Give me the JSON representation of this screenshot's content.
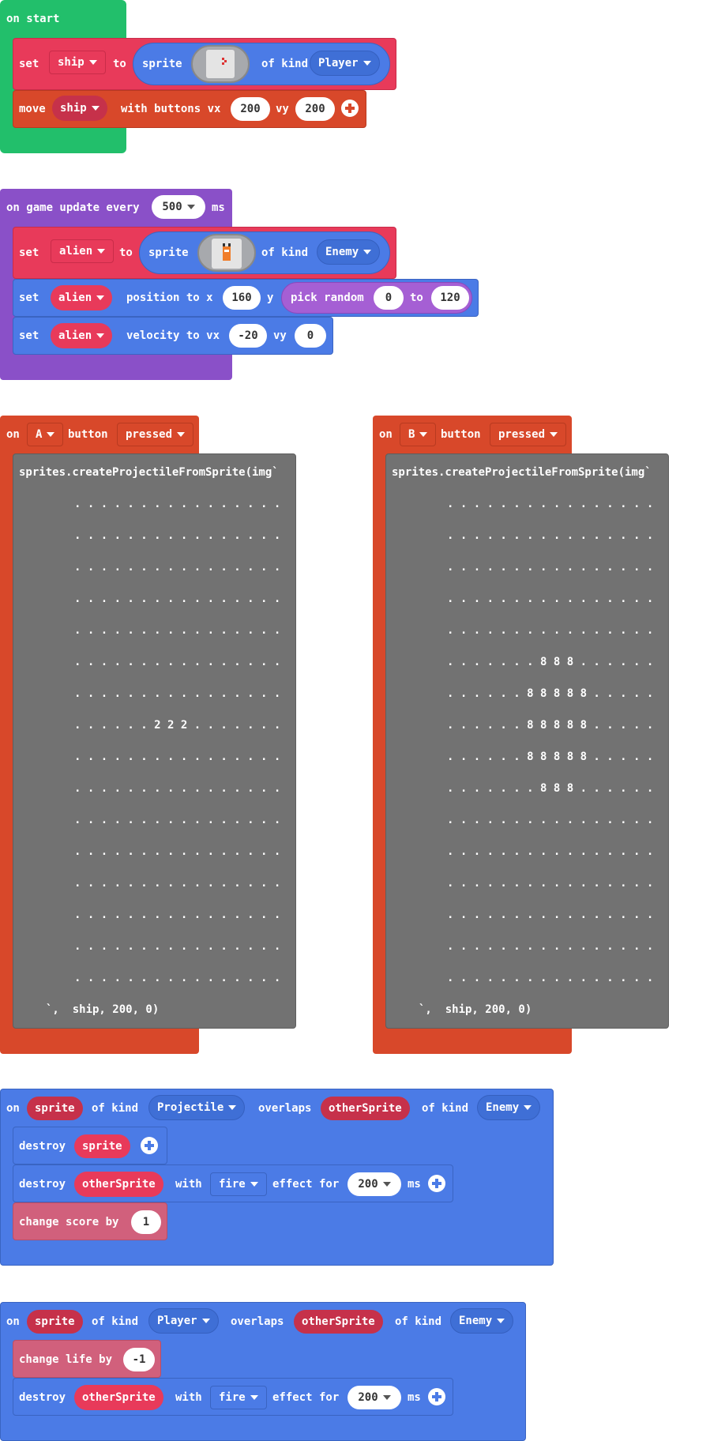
{
  "colors": {
    "event_green": "#22bf6b",
    "sprites_red": "#e83a5a",
    "controller_orange": "#d8482a",
    "game_purple": "#8a50c8",
    "sprite_blue": "#4b7be6",
    "info_pink": "#d1607c",
    "code_gray": "#727272",
    "reporter_blue": "#3f6fd6"
  },
  "on_start": {
    "label": "on start",
    "set_block": {
      "set": "set",
      "var": "ship",
      "to": "to",
      "sprite": "sprite",
      "of_kind": "of kind",
      "kind": "Player"
    },
    "move_block": {
      "move": "move",
      "var": "ship",
      "with_buttons": "with buttons vx",
      "vx": "200",
      "vy_label": "vy",
      "vy": "200"
    }
  },
  "game_update": {
    "label": "on game update every",
    "interval": "500",
    "ms": "ms",
    "set_block": {
      "set": "set",
      "var": "alien",
      "to": "to",
      "sprite": "sprite",
      "of_kind": "of kind",
      "kind": "Enemy"
    },
    "position_block": {
      "set": "set",
      "var": "alien",
      "position": "position to x",
      "x": "160",
      "y_label": "y",
      "pick_random": "pick random",
      "from": "0",
      "to": "to",
      "max": "120"
    },
    "velocity_block": {
      "set": "set",
      "var": "alien",
      "velocity": "velocity to vx",
      "vx": "-20",
      "vy_label": "vy",
      "vy": "0"
    }
  },
  "button_a": {
    "on": "on",
    "button": "A",
    "button_label": "button",
    "event": "pressed",
    "code_head": "sprites.createProjectileFromSprite(img`",
    "code_lines": [
      ". . . . . . . . . . . . . . . .",
      ". . . . . . . . . . . . . . . .",
      ". . . . . . . . . . . . . . . .",
      ". . . . . . . . . . . . . . . .",
      ". . . . . . . . . . . . . . . .",
      ". . . . . . . . . . . . . . . .",
      ". . . . . . . . . . . . . . . .",
      ". . . . . . 2 2 2 . . . . . . .",
      ". . . . . . . . . . . . . . . .",
      ". . . . . . . . . . . . . . . .",
      ". . . . . . . . . . . . . . . .",
      ". . . . . . . . . . . . . . . .",
      ". . . . . . . . . . . . . . . .",
      ". . . . . . . . . . . . . . . .",
      ". . . . . . . . . . . . . . . .",
      ". . . . . . . . . . . . . . . ."
    ],
    "code_tail": "`,  ship, 200, 0)"
  },
  "button_b": {
    "on": "on",
    "button": "B",
    "button_label": "button",
    "event": "pressed",
    "code_head": "sprites.createProjectileFromSprite(img`",
    "code_lines": [
      ". . . . . . . . . . . . . . . .",
      ". . . . . . . . . . . . . . . .",
      ". . . . . . . . . . . . . . . .",
      ". . . . . . . . . . . . . . . .",
      ". . . . . . . . . . . . . . . .",
      ". . . . . . . 8 8 8 . . . . . .",
      ". . . . . . 8 8 8 8 8 . . . . .",
      ". . . . . . 8 8 8 8 8 . . . . .",
      ". . . . . . 8 8 8 8 8 . . . . .",
      ". . . . . . . 8 8 8 . . . . . .",
      ". . . . . . . . . . . . . . . .",
      ". . . . . . . . . . . . . . . .",
      ". . . . . . . . . . . . . . . .",
      ". . . . . . . . . . . . . . . .",
      ". . . . . . . . . . . . . . . .",
      ". . . . . . . . . . . . . . . ."
    ],
    "code_tail": "`,  ship, 200, 0)"
  },
  "overlap_projectile": {
    "on": "on",
    "sprite": "sprite",
    "of_kind": "of kind",
    "kind1": "Projectile",
    "overlaps": "overlaps",
    "other": "otherSprite",
    "of_kind2": "of kind",
    "kind2": "Enemy",
    "destroy1": {
      "label": "destroy",
      "var": "sprite"
    },
    "destroy2": {
      "label": "destroy",
      "var": "otherSprite",
      "with": "with",
      "effect": "fire",
      "effect_for": "effect for",
      "ms_val": "200",
      "ms": "ms"
    },
    "score": {
      "label": "change score by",
      "value": "1"
    }
  },
  "overlap_player": {
    "on": "on",
    "sprite": "sprite",
    "of_kind": "of kind",
    "kind1": "Player",
    "overlaps": "overlaps",
    "other": "otherSprite",
    "of_kind2": "of kind",
    "kind2": "Enemy",
    "life": {
      "label": "change life by",
      "value": "-1"
    },
    "destroy": {
      "label": "destroy",
      "var": "otherSprite",
      "with": "with",
      "effect": "fire",
      "effect_for": "effect for",
      "ms_val": "200",
      "ms": "ms"
    }
  }
}
